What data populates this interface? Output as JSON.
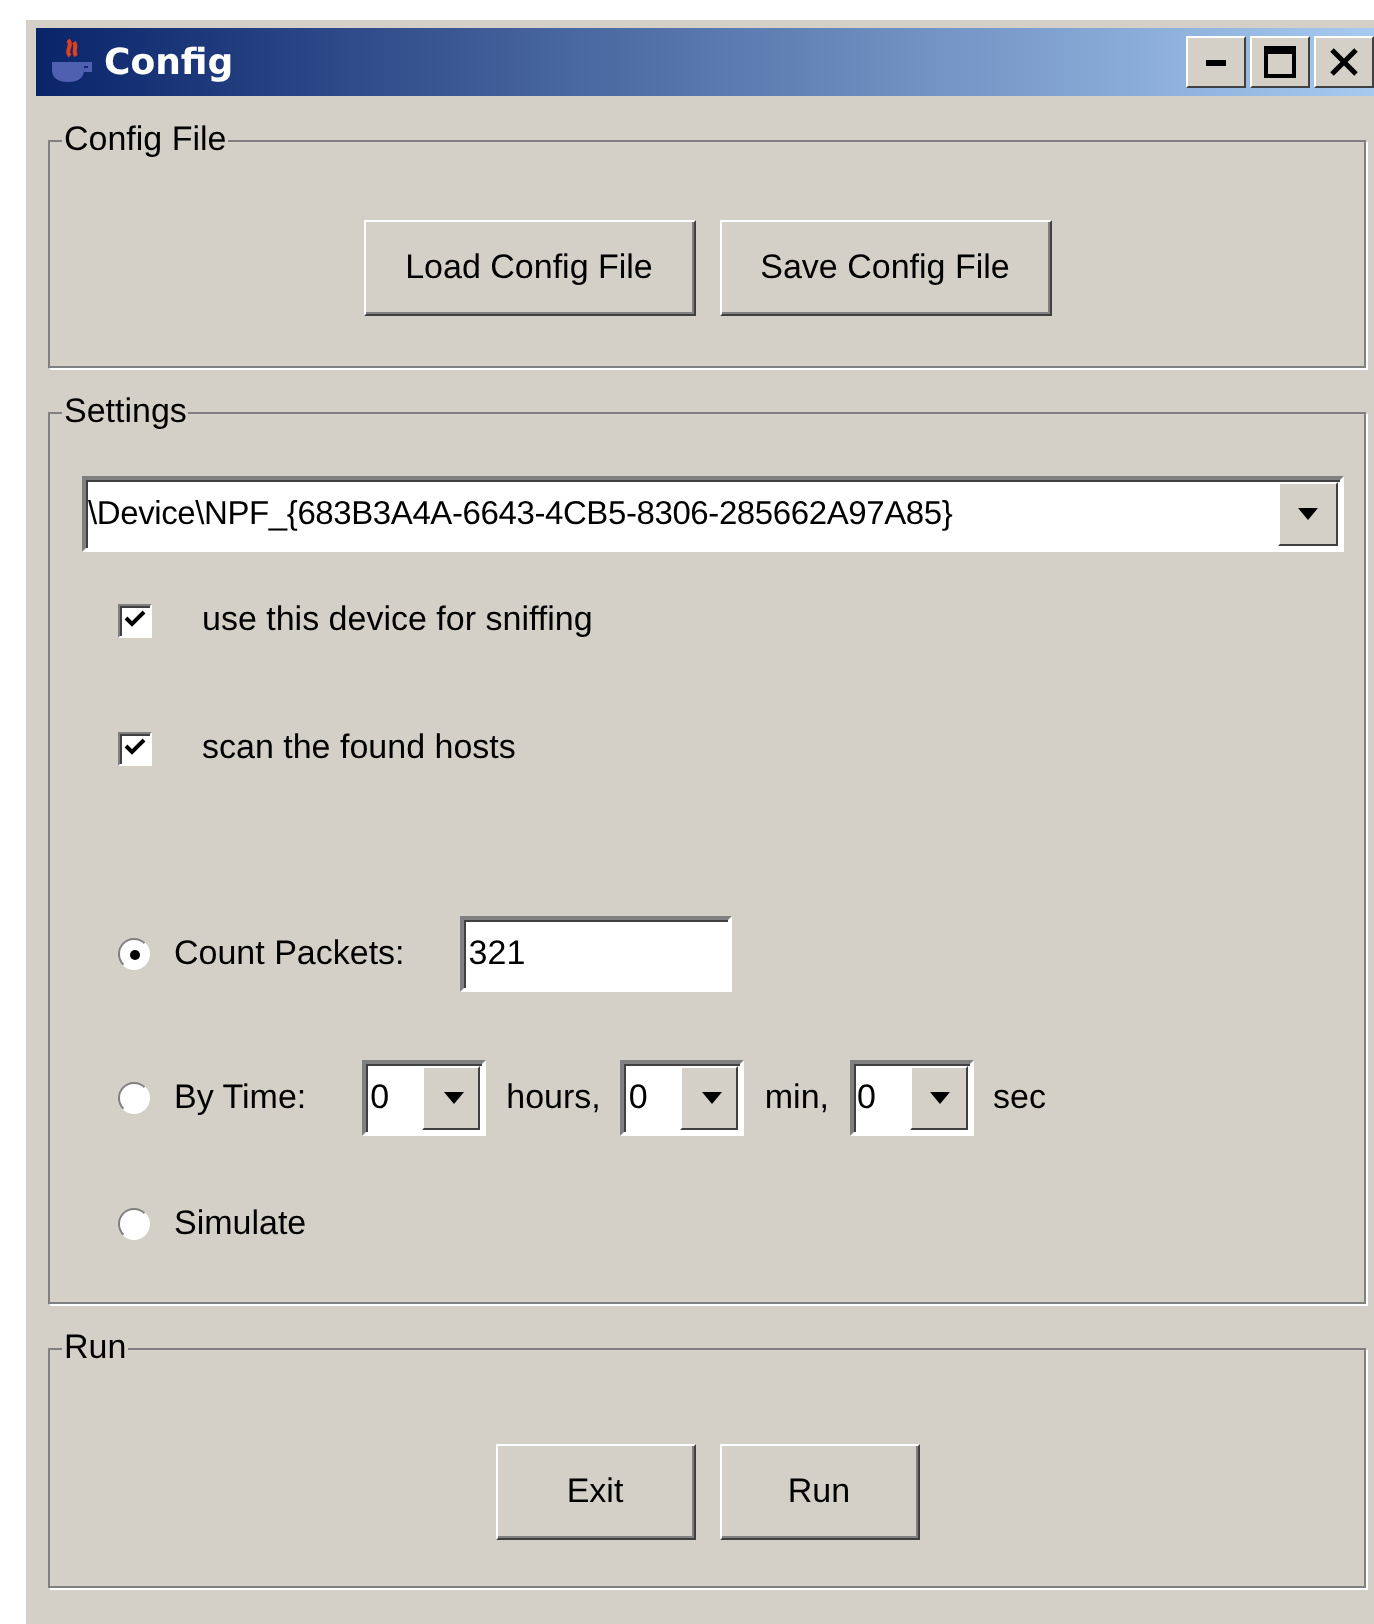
{
  "window": {
    "title": "Config"
  },
  "config_file": {
    "title": "Config File",
    "buttons": [
      "Load Config File",
      "Save Config File"
    ]
  },
  "settings": {
    "title": "Settings",
    "device": {
      "value": "\\Device\\NPF_{683B3A4A-6643-4CB5-8306-285662A97A85}"
    },
    "checkboxes": [
      {
        "label": "use this device for sniffing",
        "checked": true
      },
      {
        "label": "scan the found hosts",
        "checked": true
      }
    ],
    "modes": [
      {
        "kind": "count",
        "label": "Count Packets:",
        "selected": true,
        "value": "321"
      },
      {
        "kind": "time",
        "label": "By Time:",
        "selected": false,
        "fields": [
          {
            "value": "0",
            "unit": "hours,"
          },
          {
            "value": "0",
            "unit": "min,"
          },
          {
            "value": "0",
            "unit": "sec"
          }
        ]
      },
      {
        "kind": "plain",
        "label": "Simulate",
        "selected": false
      }
    ]
  },
  "run": {
    "title": "Run",
    "buttons": [
      "Exit",
      "Run"
    ]
  }
}
